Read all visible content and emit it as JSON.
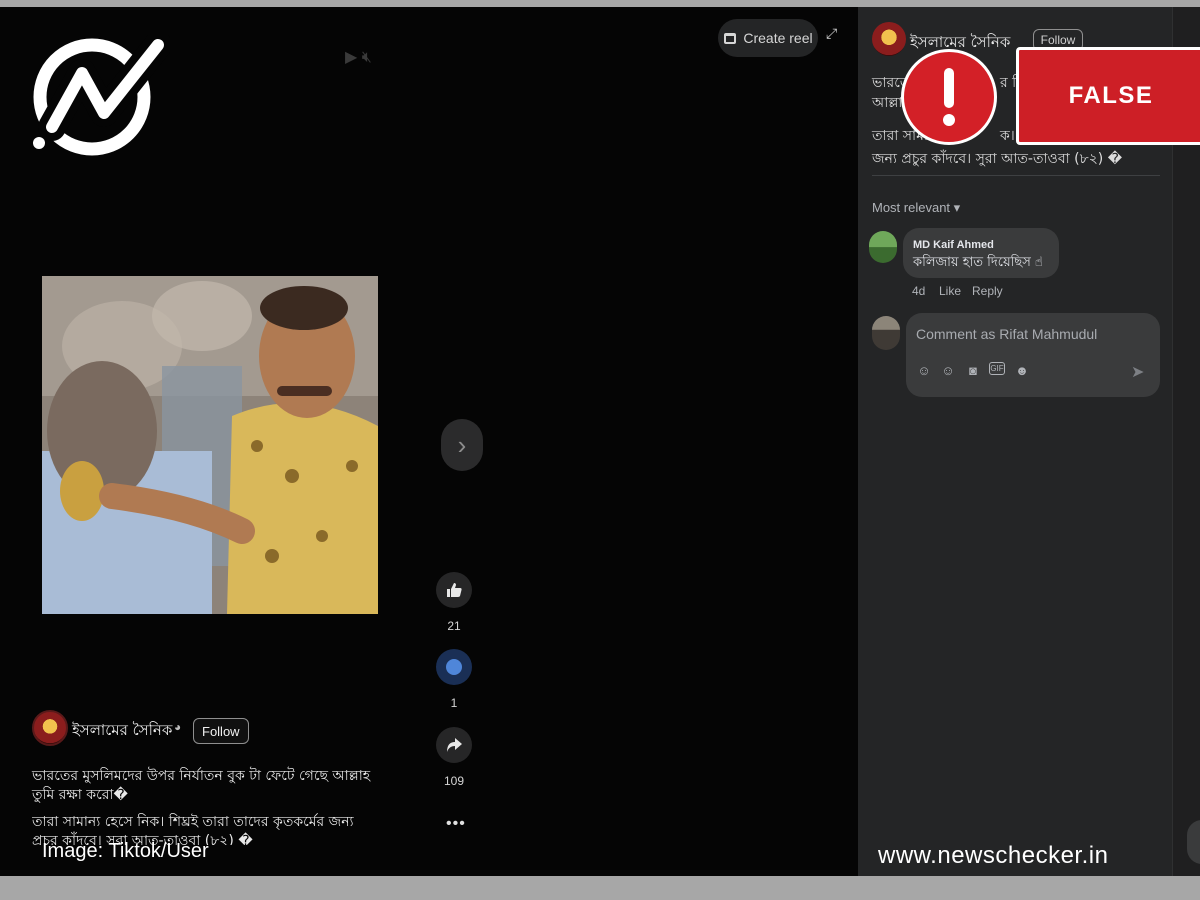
{
  "toolbar": {
    "create_reel_label": "Create reel"
  },
  "post": {
    "page_name": "ইসলামের সৈনিক",
    "follow_label": "Follow",
    "caption_line1": "ভারতের মুসলিমদের উপর নির্যাতন বুক টা ফেটে গেছে আল্লাহ তুমি রক্ষা করো�",
    "caption_line2": "তারা সামান্য হেসে নিক। শিঘ্রই তারা তাদের কৃতকর্মের জন্য প্রচুর কাঁদবে। সুরা আত-তাওবা (৮২) �"
  },
  "actions": {
    "likes": "21",
    "comments": "1",
    "shares": "109"
  },
  "side_panel": {
    "page_name": "ইসলামের সৈনিক",
    "follow_label": "Follow",
    "caption_line1": "ভারতে",
    "caption_line1b": "র নি",
    "caption_line2": "আল্লা",
    "caption_line3a": "তারা সামা",
    "caption_line3b": "ক। শি",
    "caption_line4": "জন্য প্রচুর কাঁদবে। সুরা আত-তাওবা (৮২) �",
    "sort_label": "Most relevant",
    "comment": {
      "author": "MD Kaif Ahmed",
      "text": "কলিজায় হাত দিয়েছিস ☝",
      "age": "4d",
      "like_label": "Like",
      "reply_label": "Reply"
    },
    "comment_placeholder": "Comment as Rifat Mahmudul"
  },
  "overlay": {
    "verdict": "FALSE",
    "image_credit": "Image: Tiktok/User",
    "watermark": "www.newschecker.in"
  },
  "colors": {
    "verdict_red": "#cd1f26",
    "panel_bg": "#242526",
    "bubble_bg": "#3a3b3c"
  }
}
